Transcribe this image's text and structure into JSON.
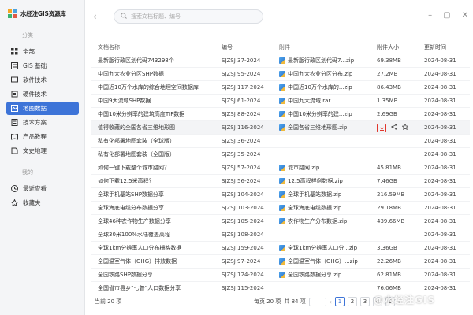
{
  "app": {
    "title": "水经注GIS资源库"
  },
  "sidebar": {
    "section_category": "分类",
    "section_mine": "我的",
    "items": [
      {
        "label": "全部",
        "icon": "grid-icon"
      },
      {
        "label": "GIS 基础",
        "icon": "gis-base-icon"
      },
      {
        "label": "软件技术",
        "icon": "software-icon"
      },
      {
        "label": "硬件技术",
        "icon": "hardware-icon"
      },
      {
        "label": "地图数据",
        "icon": "map-data-icon",
        "active": true
      },
      {
        "label": "技术方案",
        "icon": "solution-icon"
      },
      {
        "label": "产品教程",
        "icon": "tutorial-icon"
      },
      {
        "label": "文史地理",
        "icon": "history-icon"
      }
    ],
    "mine_items": [
      {
        "label": "最近查看",
        "icon": "clock-icon"
      },
      {
        "label": "收藏夹",
        "icon": "star-icon"
      }
    ]
  },
  "search": {
    "placeholder": "搜索文档标题、编号"
  },
  "table": {
    "headers": {
      "name": "文档名称",
      "code": "编号",
      "attachment": "附件",
      "size": "附件大小",
      "updated": "更新时间"
    },
    "rows": [
      {
        "name": "最新版行政区划代码743298个",
        "code": "SJZSJ 37-2024",
        "attachment": "最新版行政区划代码7...zip",
        "size": "69.38MB",
        "updated": "2024-08-31"
      },
      {
        "name": "中国九大农业分区SHP数据",
        "code": "SJZSJ 95-2024",
        "attachment": "中国九大农业分区分布.zip",
        "size": "27.2MB",
        "updated": "2024-08-31"
      },
      {
        "name": "中国近10万个水库的综合地理空间数据库",
        "code": "SJZSJ 117-2024",
        "attachment": "中国近10万个水库的...zip",
        "size": "86.43MB",
        "updated": "2024-08-31"
      },
      {
        "name": "中国9大流域SHP数据",
        "code": "SJZSJ 61-2024",
        "attachment": "中国九大流域.rar",
        "size": "1.35MB",
        "updated": "2024-08-31"
      },
      {
        "name": "中国10米分辨率的建筑高度TIF数据",
        "code": "SJZSJ 88-2024",
        "attachment": "中国10米分辨率的建...zip",
        "size": "2.69GB",
        "updated": "2024-08-31"
      },
      {
        "name": "值得收藏的全国各省三维地形图",
        "code": "SJZSJ 116-2024",
        "attachment": "全国各省三维地形图.zip",
        "size": "",
        "updated": "2024-08-31",
        "hover": true
      },
      {
        "name": "私有化部署地图套装（全球版）",
        "code": "SJZSJ 36-2024",
        "attachment": "",
        "size": "",
        "updated": "2024-08-31"
      },
      {
        "name": "私有化部署地图套装（全国版）",
        "code": "SJZSJ 35-2024",
        "attachment": "",
        "size": "",
        "updated": "2024-08-31"
      },
      {
        "name": "如何一键下载整个城市路网？",
        "code": "SJZSJ 57-2024",
        "attachment": "城市路网.zip",
        "size": "45.81MB",
        "updated": "2024-08-31"
      },
      {
        "name": "如何下载12.5米高程？",
        "code": "SJZSJ 56-2024",
        "attachment": "12.5高程样例数据.zip",
        "size": "7.46GB",
        "updated": "2024-08-31"
      },
      {
        "name": "全球手机基站SHP数据分享",
        "code": "SJZSJ 104-2024",
        "attachment": "全球手机基站数据.zip",
        "size": "216.59MB",
        "updated": "2024-08-31"
      },
      {
        "name": "全球海底电缆分布数据分享",
        "code": "SJZSJ 103-2024",
        "attachment": "全球海底电缆数据.zip",
        "size": "29.18MB",
        "updated": "2024-08-31"
      },
      {
        "name": "全球46种农作物生产数据分享",
        "code": "SJZSJ 105-2024",
        "attachment": "农作物生产分布数据.zip",
        "size": "439.66MB",
        "updated": "2024-08-31"
      },
      {
        "name": "全球30米100%水陆覆盖高程",
        "code": "SJZSJ 108-2024",
        "attachment": "",
        "size": "",
        "updated": "2024-08-31"
      },
      {
        "name": "全球1km分辨率人口分布栅格数据",
        "code": "SJZSJ 159-2024",
        "attachment": "全球1km分辨率人口分...zip",
        "size": "3.36GB",
        "updated": "2024-08-31"
      },
      {
        "name": "全国温室气体（GHG）排放数据",
        "code": "SJZSJ 97-2024",
        "attachment": "全国温室气体（GHG）...zip",
        "size": "22.26MB",
        "updated": "2024-08-31"
      },
      {
        "name": "全国铁路SHP数据分享",
        "code": "SJZSJ 124-2024",
        "attachment": "全国铁路数据分享.zip",
        "size": "62.81MB",
        "updated": "2024-08-31"
      },
      {
        "name": "全国省市县乡“七普”人口数据分享",
        "code": "SJZSJ 115-2024",
        "attachment": "",
        "size": "76.06MB",
        "updated": "2024-08-31"
      }
    ]
  },
  "footer": {
    "total": "当前 20 项",
    "per_page": "每页 20 项",
    "total_pages": "共 84 项",
    "pages": [
      "1",
      "2",
      "3",
      "4",
      "5"
    ],
    "current_page": "1"
  },
  "watermark": "@水经注GIS",
  "colors": {
    "accent": "#3d74d8",
    "download": "#e0362c"
  }
}
